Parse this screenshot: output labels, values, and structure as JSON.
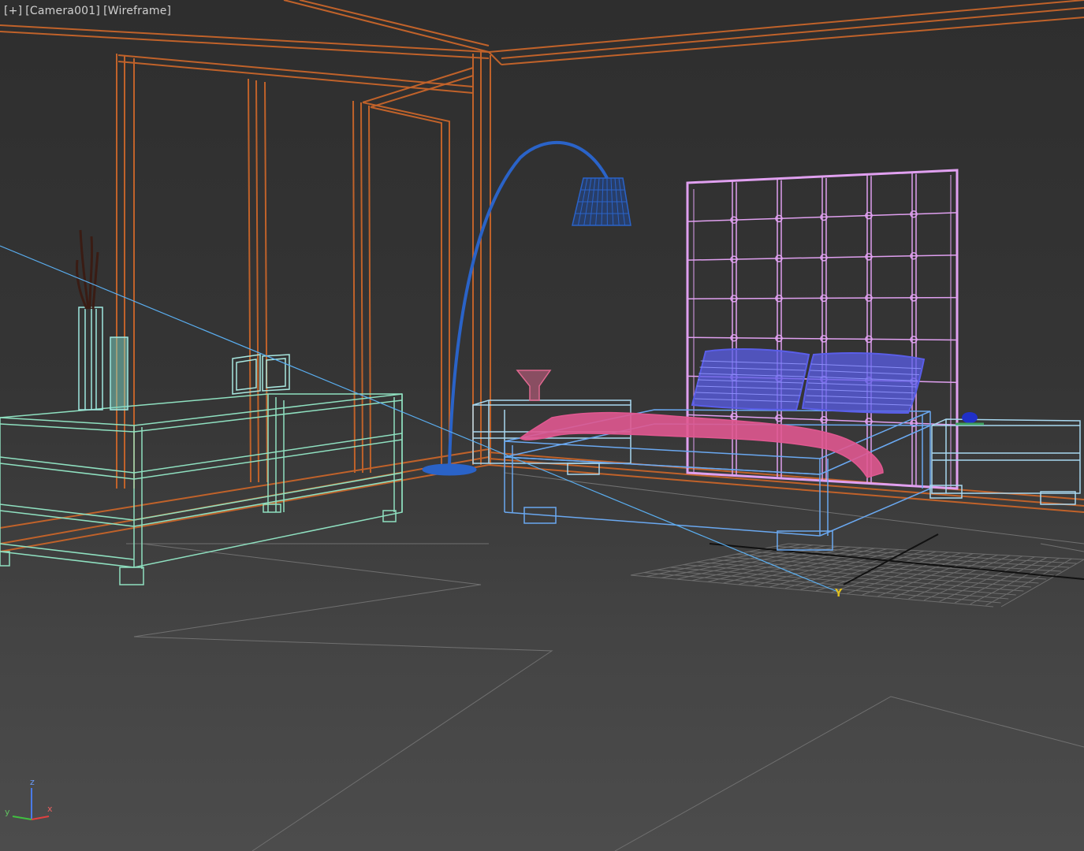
{
  "viewport": {
    "menu_label": "[+]",
    "camera_label": "[Camera001]",
    "shading_label": "[Wireframe]"
  },
  "axis_gizmo": {
    "z_label": "z",
    "x_label": "x",
    "y_label": "y"
  },
  "target_marker": {
    "label": "Y"
  },
  "colors": {
    "background": "#353535",
    "walls": "#c0622a",
    "cabinet": "#8fe0c0",
    "vase": "#9fe8e0",
    "branches": "#3a1c14",
    "lamp": "#2a63c8",
    "headboard": "#e0a0f0",
    "pillows": "#5a5ee8",
    "blanket": "#e05890",
    "bed_frame": "#6aa8f0",
    "nightstand": "#a8d8f0",
    "camera_line": "#5aaef0",
    "grid": "#6a6a6a"
  }
}
